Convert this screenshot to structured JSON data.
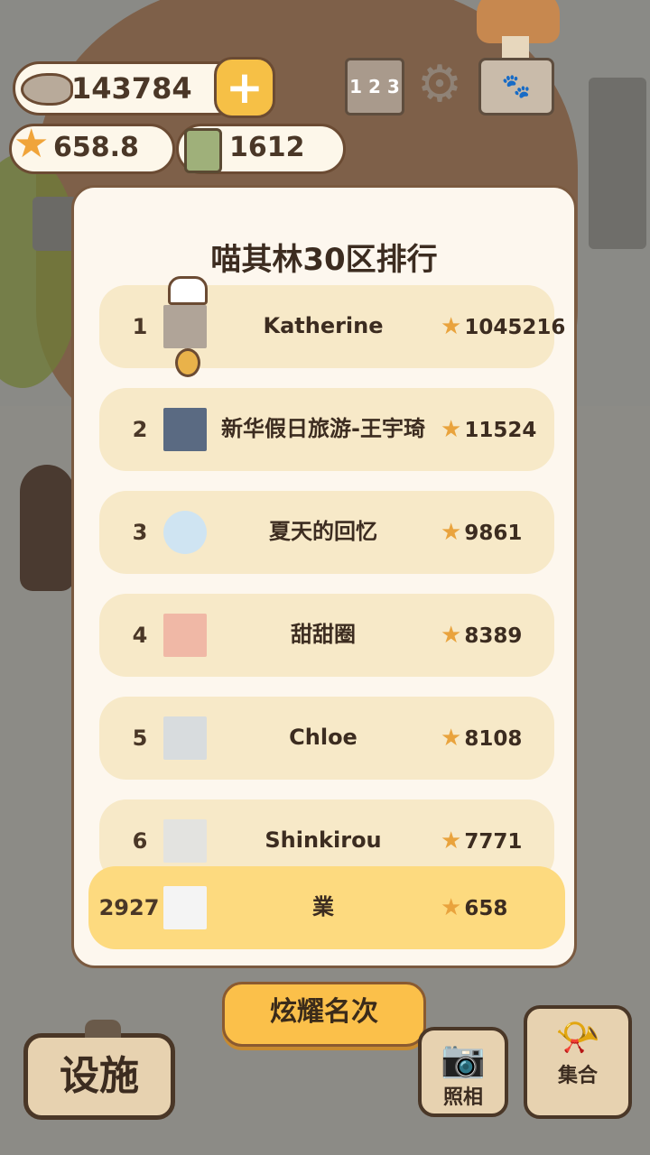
{
  "currencies": {
    "fish": "143784",
    "stars": "658.8",
    "bamboo": "1612"
  },
  "leaderboard": {
    "title": "喵其林30区排行",
    "rows": [
      {
        "rank": "1",
        "name": "Katherine",
        "score": "1045216"
      },
      {
        "rank": "2",
        "name": "新华假日旅游-王宇琦",
        "score": "11524"
      },
      {
        "rank": "3",
        "name": "夏天的回忆",
        "score": "9861"
      },
      {
        "rank": "4",
        "name": "甜甜圈",
        "score": "8389"
      },
      {
        "rank": "5",
        "name": "Chloe",
        "score": "8108"
      },
      {
        "rank": "6",
        "name": "Shinkirou",
        "score": "7771"
      }
    ],
    "me": {
      "rank": "2927",
      "name": "業",
      "score": "658"
    }
  },
  "buttons": {
    "show_rank": "炫耀名次",
    "facility": "设施",
    "photo": "照相",
    "gather": "集合"
  },
  "icons": {
    "rank_podium": "1 2 3",
    "star": "★"
  },
  "colors": {
    "panel_bg": "#fdf7ee",
    "row_bg": "#f7e9c8",
    "highlight_row": "#fdda7f",
    "button_yellow": "#fbc04a"
  }
}
